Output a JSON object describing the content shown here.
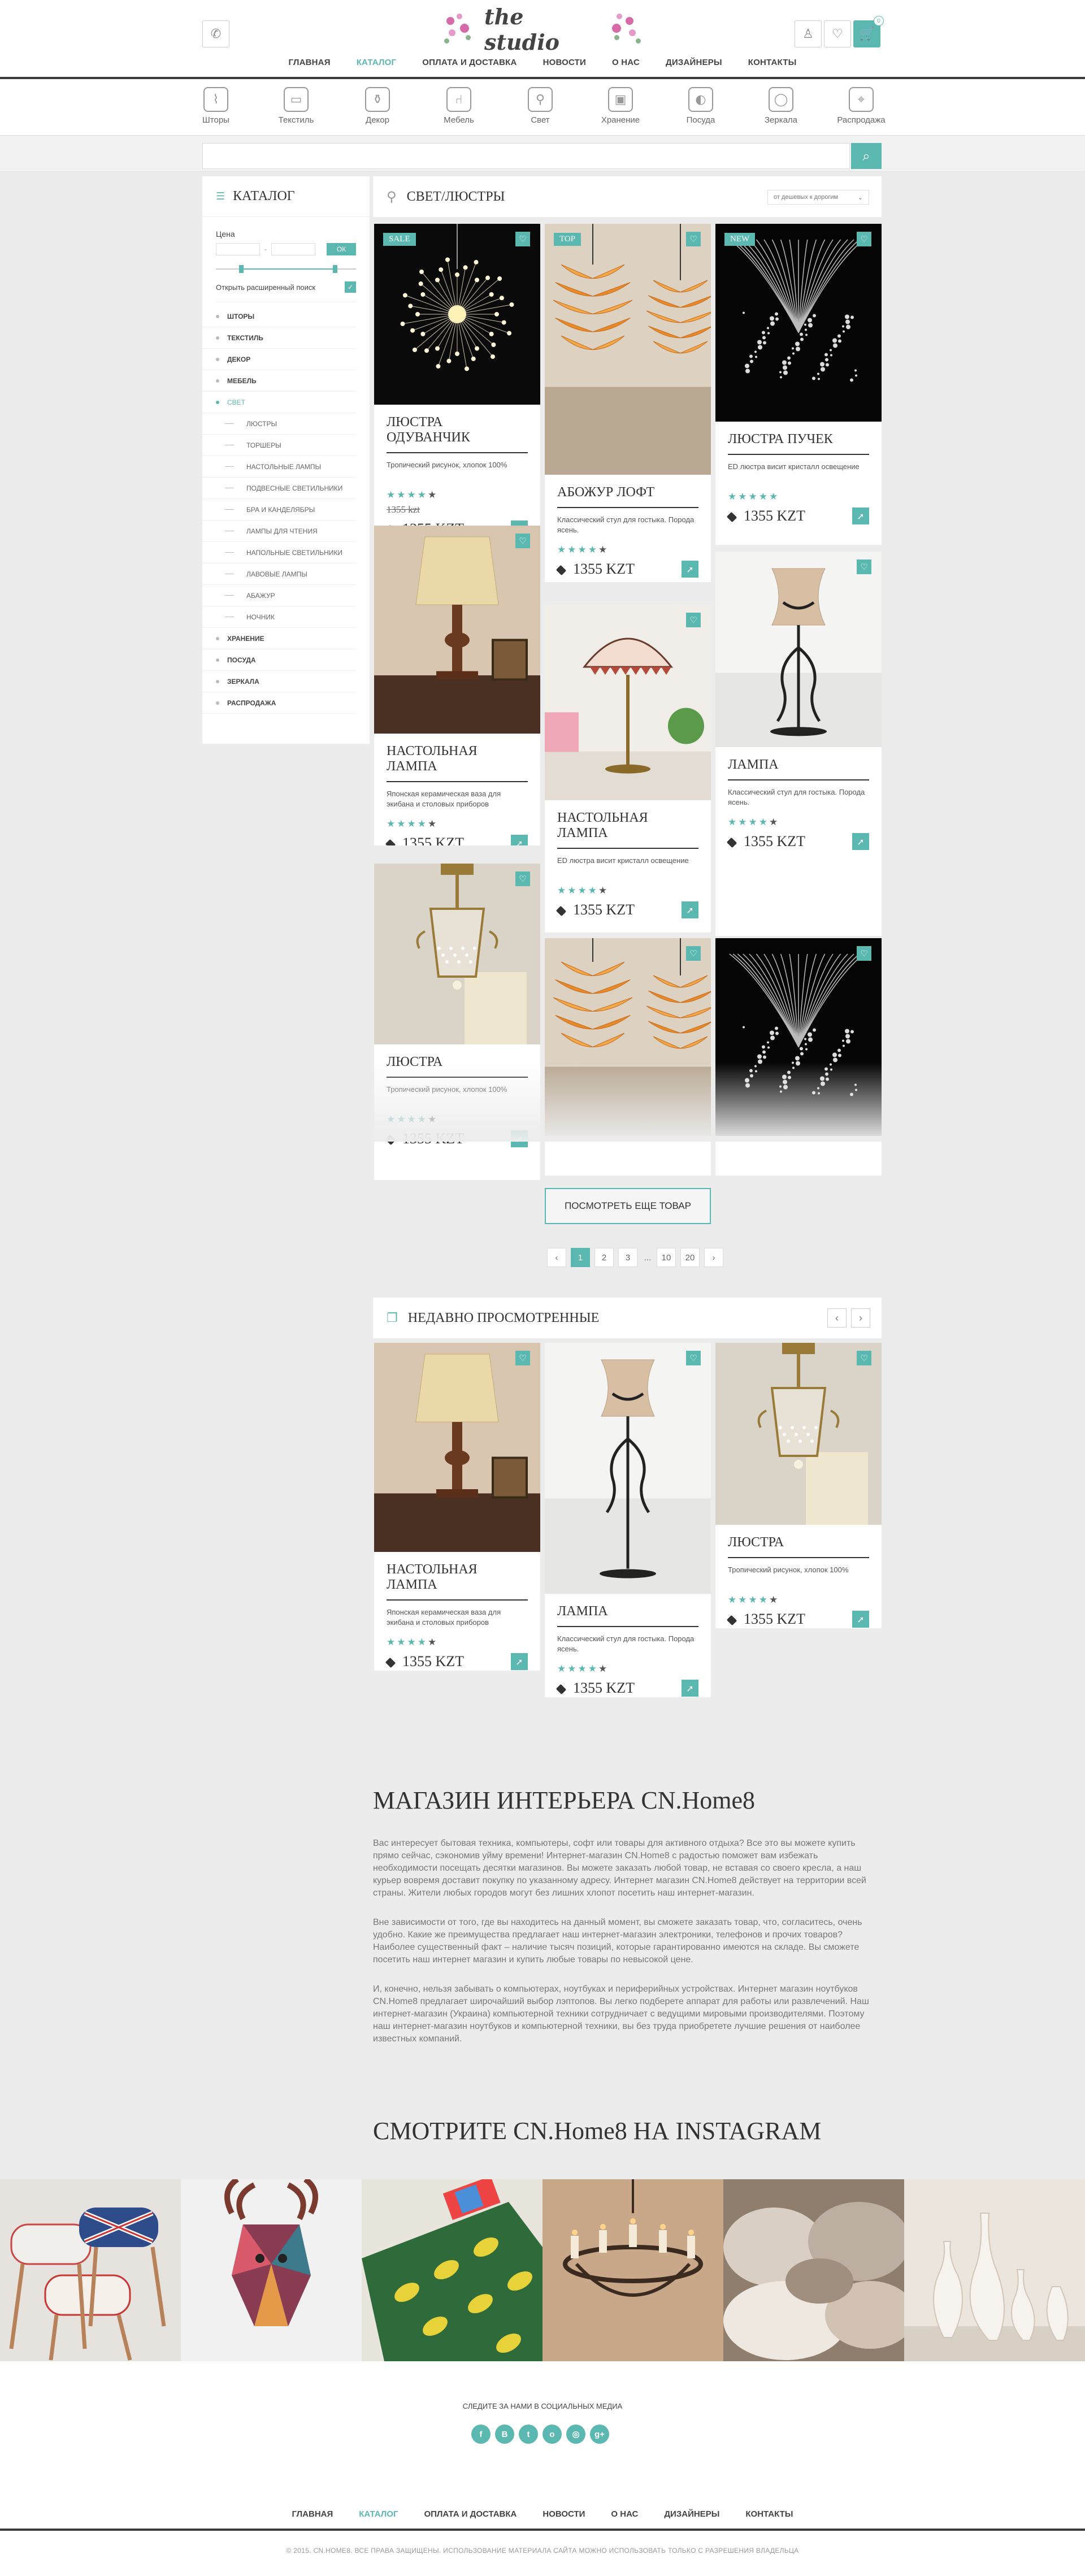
{
  "brand": {
    "logo_text": "the studio"
  },
  "header": {
    "phone_icon": "phone-icon",
    "cart_count": "0"
  },
  "nav": [
    {
      "label": "ГЛАВНАЯ"
    },
    {
      "label": "КАТАЛОГ",
      "active": true
    },
    {
      "label": "ОПЛАТА И ДОСТАВКА"
    },
    {
      "label": "НОВОСТИ"
    },
    {
      "label": "О НАС"
    },
    {
      "label": "ДИЗАЙНЕРЫ"
    },
    {
      "label": "КОНТАКТЫ"
    }
  ],
  "categories": [
    {
      "label": "Шторы",
      "icon": "curtain-icon"
    },
    {
      "label": "Текстиль",
      "icon": "pillow-icon"
    },
    {
      "label": "Декор",
      "icon": "vase-icon"
    },
    {
      "label": "Мебель",
      "icon": "chair-icon"
    },
    {
      "label": "Свет",
      "icon": "lamp-icon"
    },
    {
      "label": "Хранение",
      "icon": "box-icon"
    },
    {
      "label": "Посуда",
      "icon": "plate-icon"
    },
    {
      "label": "Зеркала",
      "icon": "mirror-icon"
    },
    {
      "label": "Распродажа",
      "icon": "sale-tag-icon"
    }
  ],
  "search": {
    "placeholder": ""
  },
  "sidebar": {
    "title": "КАТАЛОГ",
    "price_label": "Цена",
    "price_dash": "-",
    "ok_label": "ОК",
    "price_range": [
      0.18,
      0.85
    ],
    "extended_search": "Открыть расширенный поиск",
    "items": [
      {
        "label": "ШТОРЫ",
        "type": "b"
      },
      {
        "label": "ТЕКСТИЛЬ",
        "type": "b"
      },
      {
        "label": "ДЕКОР",
        "type": "b"
      },
      {
        "label": "МЕБЕЛЬ",
        "type": "b"
      },
      {
        "label": "СВЕТ",
        "type": "active"
      },
      {
        "label": "ЛЮСТРЫ",
        "type": "sub"
      },
      {
        "label": "ТОРШЕРЫ",
        "type": "sub"
      },
      {
        "label": "НАСТОЛЬНЫЕ ЛАМПЫ",
        "type": "sub"
      },
      {
        "label": "ПОДВЕСНЫЕ СВЕТИЛЬНИКИ",
        "type": "sub"
      },
      {
        "label": "БРА И КАНДЕЛЯБРЫ",
        "type": "sub"
      },
      {
        "label": "ЛАМПЫ ДЛЯ ЧТЕНИЯ",
        "type": "sub"
      },
      {
        "label": "НАПОЛЬНЫЕ СВЕТИЛЬНИКИ",
        "type": "sub"
      },
      {
        "label": "ЛАВОВЫЕ ЛАМПЫ",
        "type": "sub"
      },
      {
        "label": "АБАЖУР",
        "type": "sub"
      },
      {
        "label": "НОЧНИК",
        "type": "sub"
      },
      {
        "label": "ХРАНЕНИЕ",
        "type": "b"
      },
      {
        "label": "ПОСУДА",
        "type": "b"
      },
      {
        "label": "ЗЕРКАЛА",
        "type": "b"
      },
      {
        "label": "РАСПРОДАЖА",
        "type": "b"
      }
    ]
  },
  "catalog": {
    "title": "СВЕТ/ЛЮСТРЫ",
    "sort": "от дешевых к дорогим",
    "more_button": "ПОСМОТРЕТЬ ЕЩЕ ТОВАР",
    "pages": [
      "‹",
      "1",
      "2",
      "3",
      "...",
      "10",
      "20",
      "›"
    ]
  },
  "products": [
    {
      "title": "ЛЮСТРА ОДУВАНЧИК",
      "desc": "Тропический рисунок, хлопок 100%",
      "price": "1355 KZT",
      "old_price": "1355 kzt",
      "badge": "SALE",
      "rating": 4,
      "img": "chandelier"
    },
    {
      "title": "АБОЖУР ЛОФТ",
      "desc": "Классический стул для гостыка. Порода ясень.",
      "price": "1355 KZT",
      "badge": "TOP",
      "rating": 4,
      "img": "pinecone"
    },
    {
      "title": "ЛЮСТРА ПУЧЕК",
      "desc": "ED люстра висит кристалл освещение",
      "price": "1355 KZT",
      "badge": "NEW",
      "rating": 5,
      "img": "crystal"
    },
    {
      "title": "НАСТОЛЬНАЯ ЛАМПА",
      "desc": "Японская керамическая ваза для экибана и столовых приборов",
      "price": "1355 KZT",
      "rating": 4,
      "img": "tablelamp"
    },
    {
      "title": "НАСТОЛЬНАЯ ЛАМПА",
      "desc": "ED люстра висит кристалл освещение",
      "price": "1355 KZT",
      "rating": 4,
      "img": "tiffany"
    },
    {
      "title": "ЛАМПА",
      "desc": "Классический стул для гостыка. Порода ясень.",
      "price": "1355 KZT",
      "rating": 4,
      "img": "ironlamp"
    },
    {
      "title": "ЛЮСТРА",
      "desc": "Тропический рисунок, хлопок 100%",
      "price": "1355 KZT",
      "rating": 4,
      "img": "brass"
    },
    {
      "title": "",
      "desc": "",
      "price": "",
      "rating": 0,
      "img": "pinecone"
    },
    {
      "title": "",
      "desc": "",
      "price": "",
      "rating": 0,
      "img": "crystal"
    }
  ],
  "recent": {
    "title": "НЕДАВНО ПРОСМОТРЕННЫЕ",
    "items": [
      {
        "title": "НАСТОЛЬНАЯ ЛАМПА",
        "desc": "Японская керамическая ваза для экибана и столовых приборов",
        "price": "1355 KZT",
        "rating": 4,
        "img": "tablelamp"
      },
      {
        "title": "ЛАМПА",
        "desc": "Классический стул для гостыка. Порода ясень.",
        "price": "1355 KZT",
        "rating": 4,
        "img": "ironlamp"
      },
      {
        "title": "ЛЮСТРА",
        "desc": "Тропический рисунок, хлопок 100%",
        "price": "1355 KZT",
        "rating": 4,
        "img": "brass"
      }
    ]
  },
  "about": {
    "title": "МАГАЗИН ИНТЕРЬЕРА CN.Home8",
    "p1": "Вас интересует бытовая техника, компьютеры, софт или товары для активного отдыха? Все это вы можете купить прямо сейчас, сэкономив уйму времени! Интернет-магазин CN.Home8 с радостью поможет вам избежать необходимости посещать десятки магазинов. Вы можете заказать любой товар, не вставая со своего кресла, а наш курьер вовремя доставит покупку по указанному адресу. Интернет магазин CN.Home8 действует на территории всей страны. Жители любых городов могут без лишних хлопот посетить наш интернет-магазин.",
    "p2": "Вне зависимости от того, где вы находитесь на данный момент, вы сможете заказать товар, что, согласитесь, очень удобно. Какие же преимущества предлагает наш интернет-магазин электроники, телефонов и прочих товаров? Наиболее существенный факт – наличие тысяч позиций, которые гарантированно имеются на складе. Вы сможете посетить наш интернет магазин и купить любые товары по невысокой цене.",
    "p3": "И, конечно, нельзя забывать о компьютерах, ноутбуках и периферийных устройствах. Интернет магазин ноутбуков CN.Home8 предлагает широчайший выбор лэптопов. Вы легко подберете аппарат для работы или развлечений. Наш интернет-магазин (Украина) компьютерной техники сотрудничает с ведущими мировыми производителями. Поэтому наш интернет-магазин ноутбуков и компьютерной техники, вы без труда приобретете лучшие решения от наиболее известных компаний."
  },
  "instagram": {
    "title": "СМОТРИТЕ CN.Home8 НА INSTAGRAM"
  },
  "social": {
    "label": "СЛЕДИТЕ ЗА НАМИ В СОЦИАЛЬНЫХ МЕДИА",
    "items": [
      {
        "glyph": "f",
        "icon": "facebook-icon"
      },
      {
        "glyph": "В",
        "icon": "vk-icon"
      },
      {
        "glyph": "t",
        "icon": "twitter-icon"
      },
      {
        "glyph": "о",
        "icon": "odnoklassniki-icon"
      },
      {
        "glyph": "◎",
        "icon": "instagram-icon"
      },
      {
        "glyph": "g+",
        "icon": "googleplus-icon"
      }
    ]
  },
  "footer": {
    "copyright": "© 2015. CN.HOME8. ВСЕ ПРАВА ЗАЩИЩЕНЫ. ИСПОЛЬЗОВАНИЕ МАТЕРИАЛА САЙТА МОЖНО ИСПОЛЬЗОВАТЬ ТОЛЬКО С РАЗРЕШЕНИЯ ВЛАДЕЛЬЦА"
  },
  "colors": {
    "accent": "#5bb8b0",
    "dark": "#3a3a3a",
    "background": "#ececec"
  }
}
